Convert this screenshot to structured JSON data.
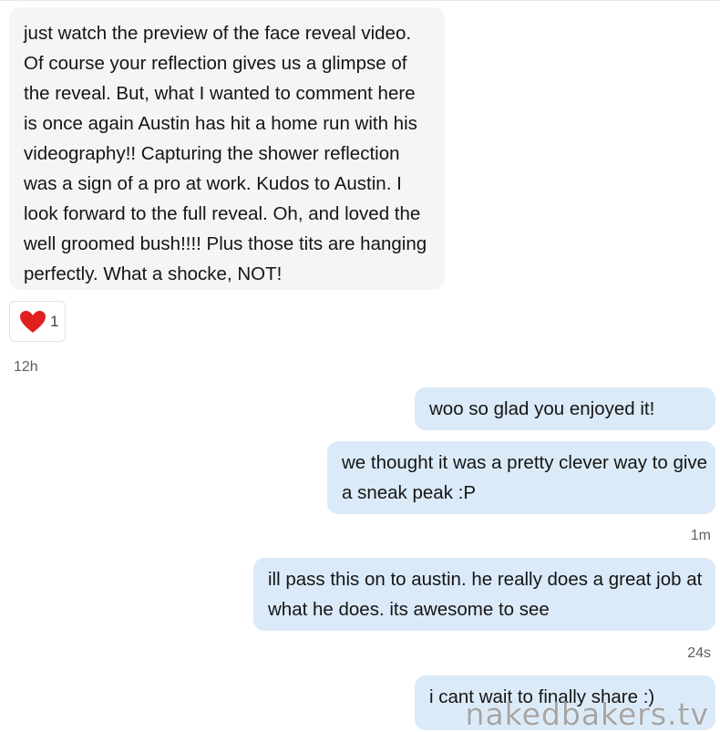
{
  "conversation": {
    "incoming_message": {
      "text": "just watch the preview of the face reveal video. Of course your reflection gives us a glimpse of the reveal. But, what I wanted to comment here is once again Austin has hit a home run with his videography!! Capturing the shower reflection was a sign of a pro at work. Kudos to Austin. I look forward to the full reveal. Oh, and loved the well groomed bush!!!! Plus those tits are hanging perfectly. What a shocke, NOT!",
      "reaction": {
        "icon": "heart-icon",
        "count": "1",
        "color": "#e0201f"
      },
      "timestamp": "12h"
    },
    "outgoing_messages": [
      {
        "text": "woo so glad you enjoyed it!"
      },
      {
        "text": "we thought it was a pretty clever way to give a sneak peak :P",
        "timestamp": "1m"
      },
      {
        "text": "ill pass this on to austin. he really does a great job at what he does. its awesome to see",
        "timestamp": "24s"
      },
      {
        "text": "i cant wait to finally share :)"
      }
    ]
  },
  "watermark": "nakedbakers.tv",
  "colors": {
    "incoming_bubble": "#f3f5f7",
    "outgoing_bubble": "#dbeaf8",
    "timestamp_text": "#5a5f66"
  }
}
